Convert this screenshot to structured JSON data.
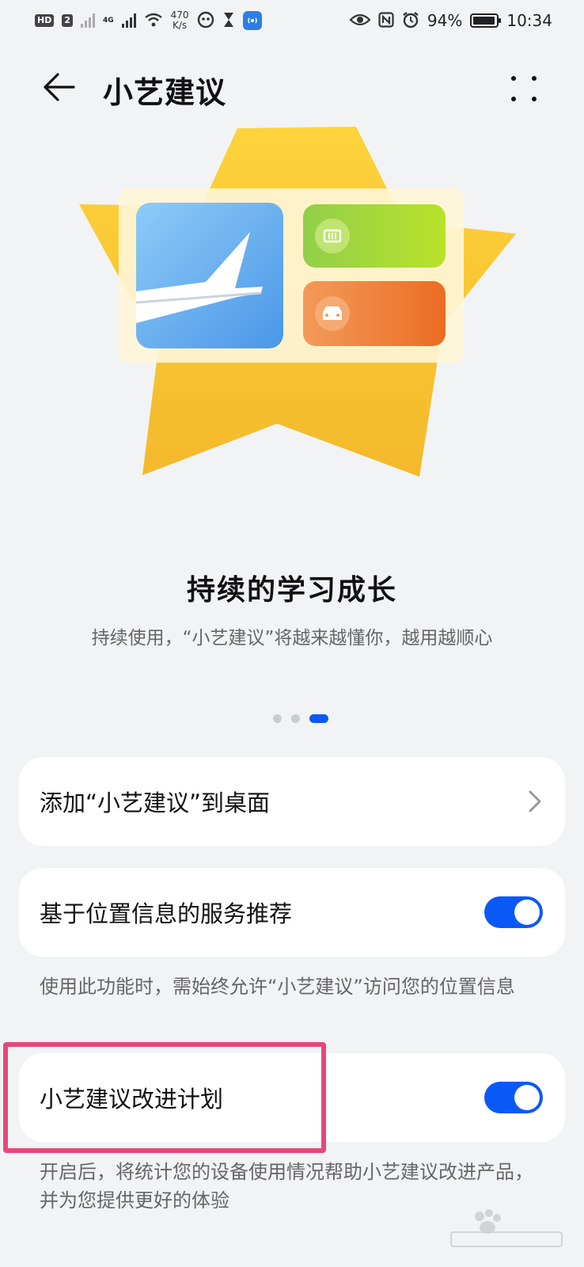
{
  "status_bar": {
    "hd_chip": "HD",
    "sim_chip": "2",
    "network_type": "4G",
    "speed_value": "470",
    "speed_unit": "K/s",
    "battery_percent": "94%",
    "time": "10:34",
    "battery_level": 0.94
  },
  "app_bar": {
    "title": "小艺建议"
  },
  "carousel": {
    "headline": "持续的学习成长",
    "subline": "持续使用，“小艺建议”将越来越懂你，越用越顺心",
    "page_count": 3,
    "active_index": 2
  },
  "settings": {
    "add_to_desktop": {
      "label": "添加“小艺建议”到桌面"
    },
    "location_service": {
      "label": "基于位置信息的服务推荐",
      "enabled": true,
      "note": "使用此功能时，需始终允许“小艺建议”访问您的位置信息"
    },
    "improvement_plan": {
      "label": "小艺建议改进计划",
      "enabled": true,
      "note": "开启后，将统计您的设备使用情况帮助小艺建议改进产品，并为您提供更好的体验"
    }
  },
  "colors": {
    "accent": "#0a59f7",
    "highlight_border": "#e8477a",
    "star": "#f7c531",
    "tile_blue": "#6fb3f2",
    "tile_green": "#a6d84a",
    "tile_orange": "#f08a3c"
  },
  "icons": {
    "back": "back-arrow-icon",
    "more": "more-dots-icon",
    "chevron": "chevron-right-icon"
  }
}
